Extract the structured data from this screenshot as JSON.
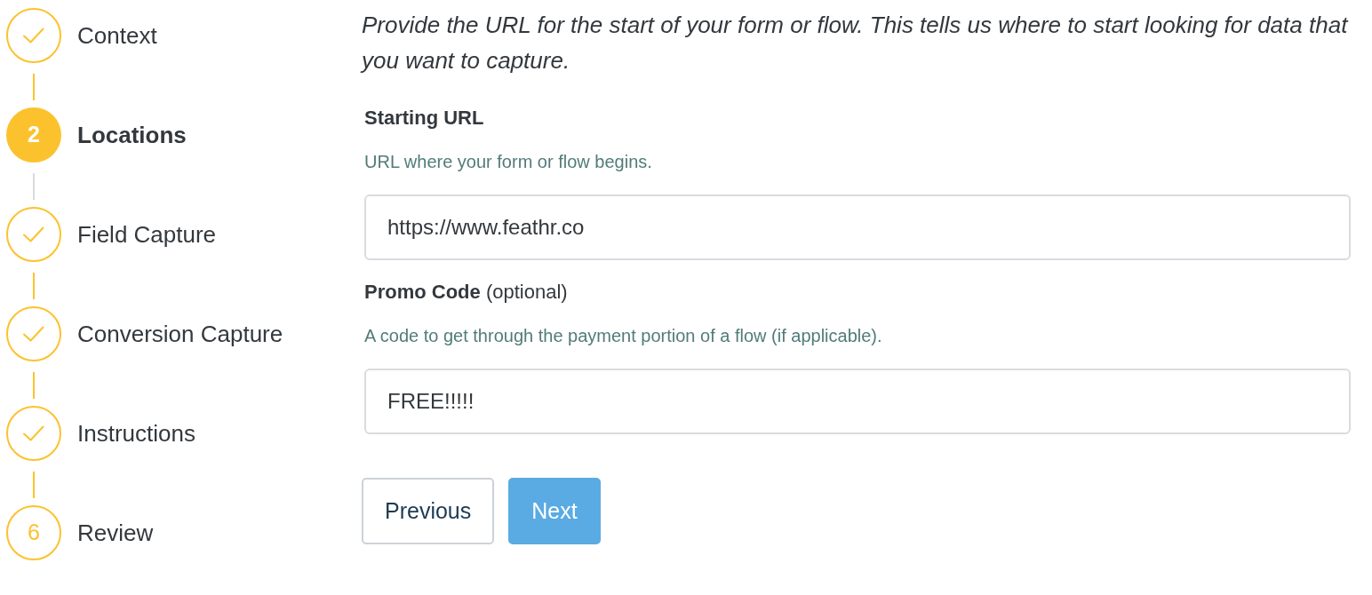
{
  "steps": [
    {
      "label": "Context",
      "completed": true,
      "current": false
    },
    {
      "label": "Locations",
      "completed": false,
      "current": true,
      "number": "2"
    },
    {
      "label": "Field Capture",
      "completed": true,
      "current": false
    },
    {
      "label": "Conversion Capture",
      "completed": true,
      "current": false
    },
    {
      "label": "Instructions",
      "completed": true,
      "current": false
    },
    {
      "label": "Review",
      "completed": false,
      "current": false,
      "number": "6"
    }
  ],
  "intro": "Provide the URL for the start of your form or flow. This tells us where to start looking for data that you want to capture.",
  "fields": [
    {
      "label": "Starting URL",
      "hint": "URL where your form or flow begins.",
      "value": "https://www.feathr.co"
    },
    {
      "label": "Promo Code",
      "note": "(optional)",
      "hint": "A code to get through the payment portion of a flow (if applicable).",
      "value": "FREE!!!!!"
    }
  ],
  "buttons": [
    {
      "label": "Previous",
      "kind": "secondary"
    },
    {
      "label": "Next",
      "kind": "primary"
    }
  ]
}
